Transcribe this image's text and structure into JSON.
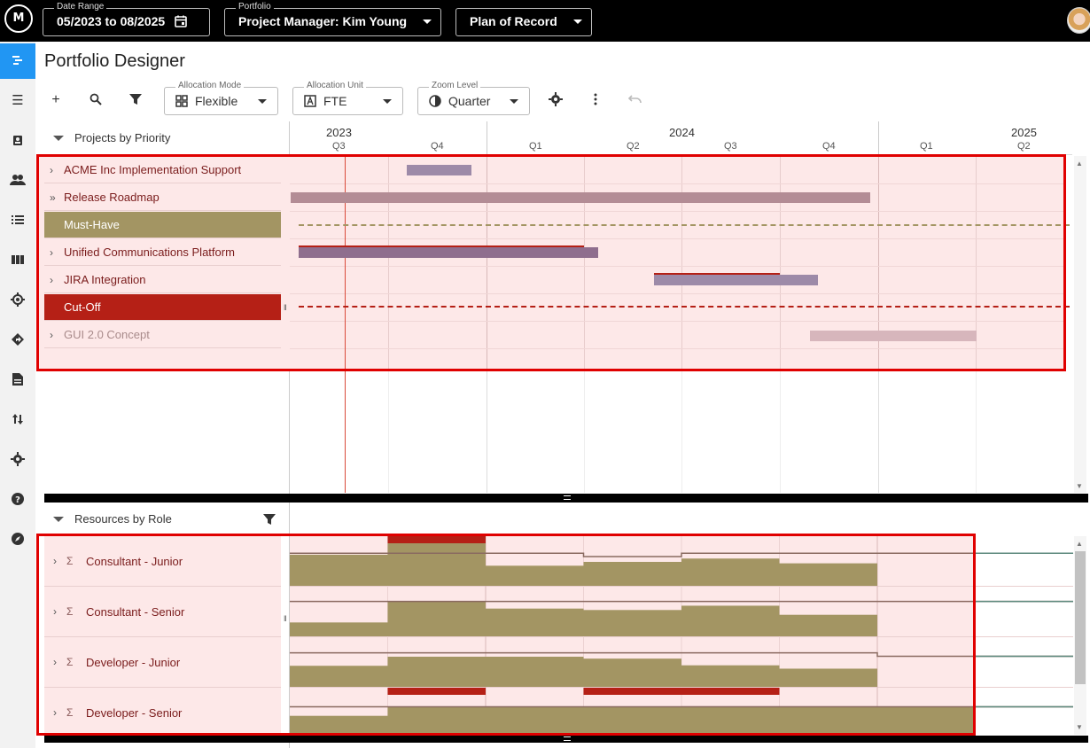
{
  "topbar": {
    "logo_text": "M",
    "date_range": {
      "legend": "Date Range",
      "value": "05/2023 to 08/2025",
      "icon": "calendar-icon"
    },
    "portfolio": {
      "legend": "Portfolio",
      "value": "Project Manager: Kim Young"
    },
    "plan": {
      "value": "Plan of Record"
    }
  },
  "sidenav": {
    "items": [
      {
        "icon": "timeline-icon",
        "active": true
      },
      {
        "icon": "user-list-icon"
      },
      {
        "icon": "badge-icon"
      },
      {
        "icon": "people-icon"
      },
      {
        "icon": "list-icon"
      },
      {
        "icon": "columns-icon"
      },
      {
        "icon": "target-icon"
      },
      {
        "icon": "direction-icon"
      },
      {
        "icon": "document-icon"
      },
      {
        "icon": "swap-icon"
      },
      {
        "icon": "gear-icon"
      },
      {
        "icon": "help-icon"
      },
      {
        "icon": "compass-icon"
      }
    ]
  },
  "page": {
    "title": "Portfolio Designer"
  },
  "toolbar": {
    "allocation_mode": {
      "legend": "Allocation Mode",
      "value": "Flexible"
    },
    "allocation_unit": {
      "legend": "Allocation Unit",
      "value": "FTE"
    },
    "zoom_level": {
      "legend": "Zoom Level",
      "value": "Quarter"
    }
  },
  "projects": {
    "header": "Projects by Priority",
    "rows": [
      {
        "label": "ACME Inc Implementation Support",
        "kind": "project",
        "chevron": "›"
      },
      {
        "label": "Release Roadmap",
        "kind": "project",
        "chevron": "»"
      },
      {
        "label": "Must-Have",
        "kind": "musthave"
      },
      {
        "label": "Unified Communications Platform",
        "kind": "project",
        "chevron": "›"
      },
      {
        "label": "JIRA Integration",
        "kind": "project",
        "chevron": "›"
      },
      {
        "label": "Cut-Off",
        "kind": "cutoff"
      },
      {
        "label": "GUI 2.0 Concept",
        "kind": "muted",
        "chevron": "›"
      }
    ]
  },
  "timeline": {
    "years": [
      {
        "label": "2023"
      },
      {
        "label": "2024"
      },
      {
        "label": "2025"
      }
    ],
    "quarters": [
      "Q3",
      "Q4",
      "Q1",
      "Q2",
      "Q3",
      "Q4",
      "Q1",
      "Q2"
    ]
  },
  "resources": {
    "header": "Resources by Role",
    "rows": [
      {
        "label": "Consultant - Junior"
      },
      {
        "label": "Consultant - Senior"
      },
      {
        "label": "Developer - Junior"
      },
      {
        "label": "Developer - Senior"
      }
    ]
  },
  "colors": {
    "accent": "#2196f3",
    "must_have": "#a39563",
    "cut_off": "#b52016",
    "allocation": "#a39563",
    "over_allocation": "#b52016",
    "bar_purple": "#9d8aa8",
    "bar_mauve": "#b38c95",
    "bar_pink": "#d7b6bc",
    "capacity_line": "#8a6a60",
    "row_tint": "#fde8e8"
  },
  "chart_data": {
    "type": "area",
    "x": [
      "2023 Q3",
      "2023 Q4",
      "2024 Q1",
      "2024 Q2",
      "2024 Q3",
      "2024 Q4",
      "2025 Q1",
      "2025 Q2"
    ],
    "series": [
      {
        "name": "Consultant - Junior",
        "values": [
          0.65,
          1.0,
          0.42,
          0.5,
          0.57,
          0.47,
          0,
          0
        ],
        "capacity": [
          0.68,
          0.68,
          0.68,
          0.61,
          0.68,
          0.68,
          0.68,
          0.68
        ],
        "over": [
          false,
          true,
          false,
          false,
          false,
          false,
          false,
          false
        ]
      },
      {
        "name": "Consultant - Senior",
        "values": [
          0.29,
          0.73,
          0.58,
          0.55,
          0.64,
          0.45,
          0,
          0
        ],
        "capacity": [
          0.73,
          0.73,
          0.73,
          0.73,
          0.73,
          0.73,
          0.73,
          0.73
        ]
      },
      {
        "name": "Developer - Junior",
        "values": [
          0.44,
          0.63,
          0.63,
          0.59,
          0.45,
          0.38,
          0,
          0
        ],
        "capacity": [
          0.71,
          0.71,
          0.71,
          0.71,
          0.71,
          0.71,
          0.64,
          0.64
        ]
      },
      {
        "name": "Developer - Senior",
        "values": [
          0.45,
          0.64,
          0.64,
          0.64,
          0.65,
          0.65,
          0.64,
          0
        ],
        "capacity": [
          0.64,
          0.64,
          0.64,
          0.64,
          0.64,
          0.64,
          0.64,
          0.64
        ],
        "over": [
          false,
          true,
          false,
          true,
          true,
          false,
          false,
          false
        ]
      }
    ]
  }
}
